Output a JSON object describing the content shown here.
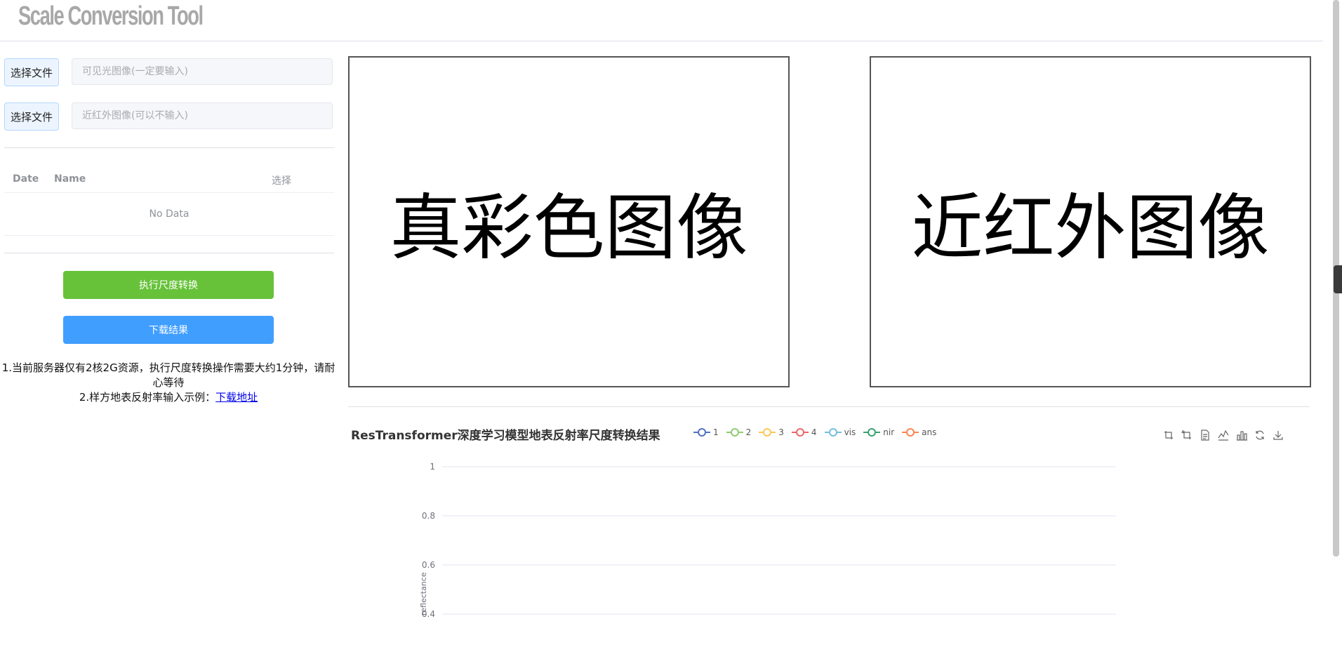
{
  "app": {
    "title": "Scale Conversion Tool"
  },
  "inputs": [
    {
      "button_label": "选择文件",
      "placeholder": "可见光图像(一定要输入)"
    },
    {
      "button_label": "选择文件",
      "placeholder": "近红外图像(可以不输入)"
    }
  ],
  "table": {
    "columns": [
      "Date",
      "Name",
      "选择"
    ],
    "empty_text": "No Data"
  },
  "actions": {
    "convert_label": "执行尺度转换",
    "download_label": "下载结果"
  },
  "notes": {
    "line1": "1.当前服务器仅有2核2G资源，执行尺度转换操作需要大约1分钟，请耐心等待",
    "line2_prefix": "2.样方地表反射率输入示例：",
    "line2_link": "下载地址"
  },
  "images": {
    "truecolor_label": "真彩色图像",
    "nir_label": "近红外图像"
  },
  "chart_data": {
    "type": "line",
    "title": "ResTransformer深度学习模型地表反射率尺度转换结果",
    "ylabel": "reflectance",
    "y_ticks": [
      "1",
      "0.8",
      "0.6",
      "0.4"
    ],
    "legend_position": "top",
    "series": [
      {
        "name": "1",
        "color": "#5470c6",
        "values": []
      },
      {
        "name": "2",
        "color": "#91cc75",
        "values": []
      },
      {
        "name": "3",
        "color": "#fac858",
        "values": []
      },
      {
        "name": "4",
        "color": "#ee6666",
        "values": []
      },
      {
        "name": "vis",
        "color": "#73c0de",
        "values": []
      },
      {
        "name": "nir",
        "color": "#3ba272",
        "values": []
      },
      {
        "name": "ans",
        "color": "#fc8452",
        "values": []
      }
    ],
    "toolbox": [
      "zoom-icon",
      "zoom-reset-icon",
      "data-view-icon",
      "line-chart-icon",
      "bar-chart-icon",
      "restore-icon",
      "save-image-icon"
    ]
  }
}
